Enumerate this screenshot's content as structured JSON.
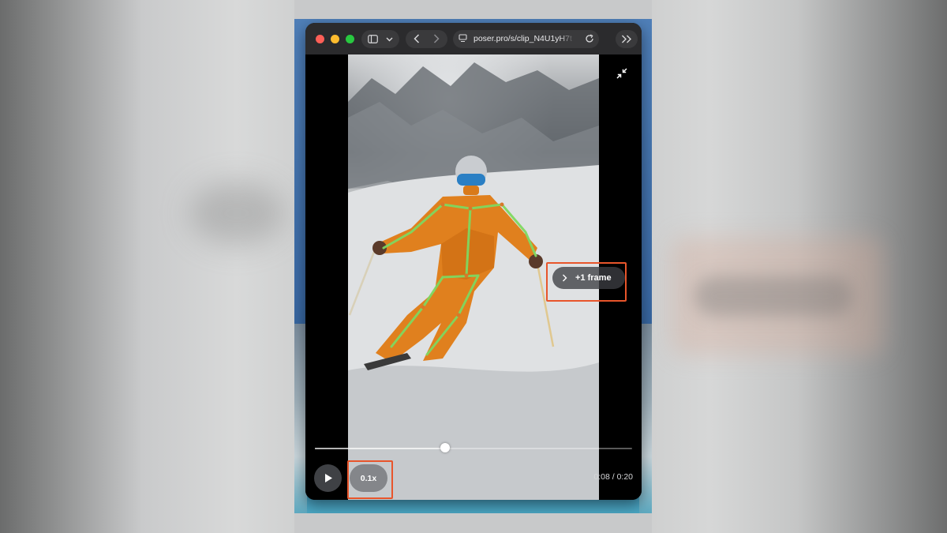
{
  "browser": {
    "url": "poser.pro/s/clip_N4U1yH7t",
    "icons": {
      "sidebar": "sidebar-icon",
      "chevron": "chevron-down-icon",
      "back": "back-arrow-icon",
      "forward": "forward-arrow-icon",
      "site": "site-settings-icon",
      "reload": "reload-icon",
      "more": "double-chevron-right-icon"
    }
  },
  "player": {
    "next_frame_label": "+1 frame",
    "speed_label": "0.1x",
    "current_time": "0:08",
    "time_separator": "/",
    "duration": "0:20",
    "progress": 0.41,
    "overlay_color": "#7fd860",
    "highlight_color": "#e8552b"
  }
}
